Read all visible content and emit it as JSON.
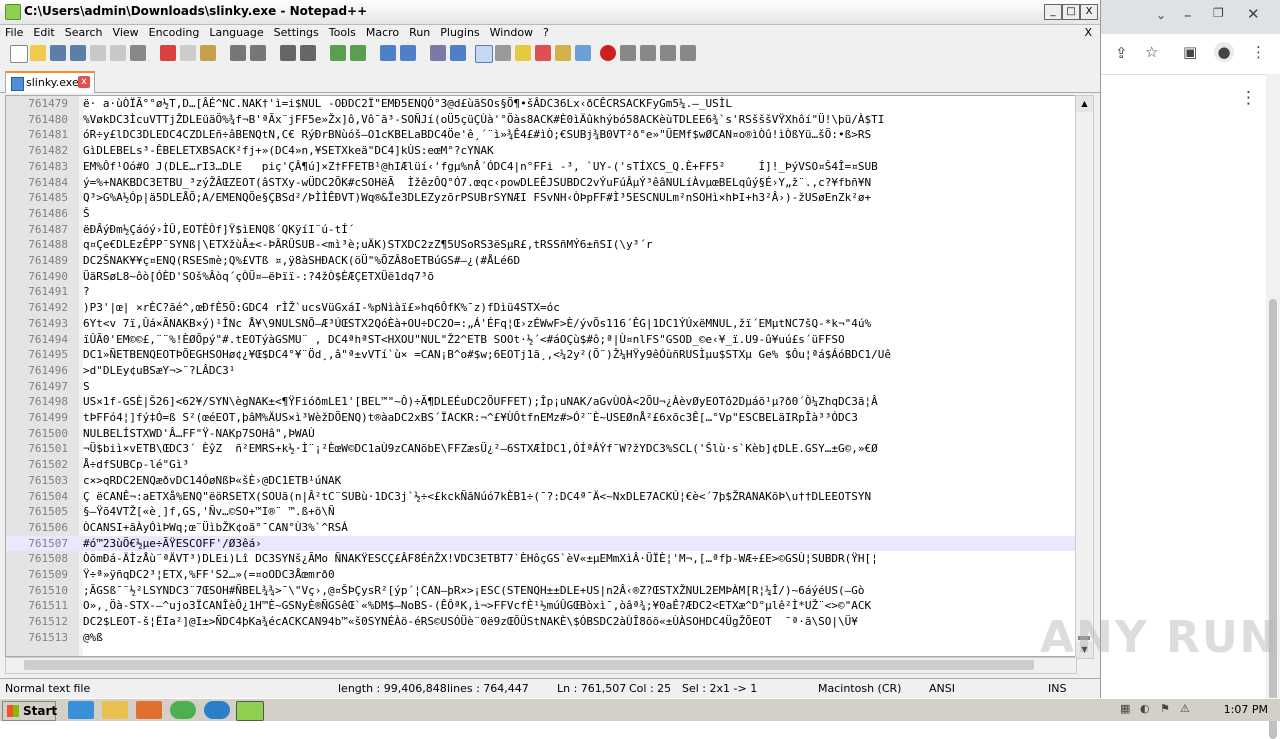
{
  "window": {
    "title": "C:\\Users\\admin\\Downloads\\slinky.exe - Notepad++",
    "min": "_",
    "max": "□",
    "close": "X"
  },
  "menu": {
    "items": [
      "File",
      "Edit",
      "Search",
      "View",
      "Encoding",
      "Language",
      "Settings",
      "Tools",
      "Macro",
      "Run",
      "Plugins",
      "Window",
      "?"
    ],
    "close": "X"
  },
  "tab": {
    "label": "slinky.exe",
    "close": "x"
  },
  "editor": {
    "lines": [
      {
        "n": "761479",
        "t": "ë· a·ùÒÏÃ°°ø½T,D…[ÂÉ^NC.NAK†'ì=i$NUL -OÐDC2Ï\"EMÐ5ENQÒ°3@d£ùãSOs§Ö¶•šÂDC36Lx‹ðCÊCRSACKFyGm5¼.—_USÌL"
      },
      {
        "n": "761480",
        "t": "%VøkDC3ÌcuVTTjŽDLEüäÖ%¾f¬B'ªÃx¨jFF5e»Žx]ô,Vô¯ã³-SOÑJí(oÜ5çüÇÙà'°Öàs8ACK#È0ìÄûkhýbó58ACKèùTDLEE6¾`s'RSšššVŸXhôí\"Ü!\\þü/À$TI"
      },
      {
        "n": "761481",
        "t": "óR÷y£lDC3DLEDC4CZDLEñ÷âBENQtN,C€ RýÐrBNùóš—O1cKBELaBDC4Öe'ê¸´¨ì»¾Ê4£#ìÒ;€SUBj¾B0VT²ð°e»\"ÜEMf$wØCAN¤o®ìÒû!ìÒßYü…šÖ:•ß>RS"
      },
      {
        "n": "761482",
        "t": "GìDLEBELs³-ÊBELETXBSACK²fj+»(DC4»n‚¥SETXkeä\"DC4]kÙS:eœM°?cYNAK"
      },
      {
        "n": "761483",
        "t": "EM%Ôf¹Oó#O J(DLE…rI3…DLE   piç'ÇÂ¶ú]×Z†FFETB¹@hIÆlüí‹'fgµ%nÂ´ÓDC4|n°FFi -³, `UY-('sTÍXCS_Q.È+FF5²     Í]!_ÞýVSO¤Š4Î=¤SUB"
      },
      {
        "n": "761484",
        "t": "ý=%+NAKBDC3ETBU_³zýŽÂŒZEOT(âSTXy-wÜDC2ÕK#cSOHëÃ  ÌžêzÔQ°Ó7.œqc‹powDLEÊJSUBDC2vÝuFúÂµÝ³êâNULíÀvµœBELqûý§É›Y„ž¨.,c?¥fbñ¥N"
      },
      {
        "n": "761485",
        "t": "Q³>G%A½Óp|ä5DLEÅÕ;A/EMENQÕe§ÇBSd²/ÞÌÌÊÐVT)Wq®&Ïe3DLEZyzõrPSUBrSYNÆI FSvNH‹ÒÞpFF#Ì³5ESCNULm²nSOHì×hÞI+h3²Â›)-žUSøEnZk²ø+"
      },
      {
        "n": "761486",
        "t": "Š"
      },
      {
        "n": "761487",
        "t": "ëÐÂýÐm½Çáóý›ÌÛ,EOTÈÒf]Ÿ$ìENQß´QKÿíI¨ú-tÍ´"
      },
      {
        "n": "761488",
        "t": "q¤Çe€DLEzÊPP¯SYNß|\\ETXžùÂ±<-ÞÂRÛSUB-<mì³è;uÄK)STXDC2zZ¶5USoRS3ëSµR£,tRSSñMÝ6±ñSI(\\y³´r"
      },
      {
        "n": "761489",
        "t": "DC2ŠNAK¥¥ç¤ENQ(RSESmè;Q%£VTß ¤,ÿ8àSHÐACK(öÜ\"%ÕZÂ8oETBúGS#—¿(#ÅLé6D"
      },
      {
        "n": "761490",
        "t": "ÜäRSøL8~ôò[ÓÈD'SOš%Âòq´çÒÜ¤—ëÞïï-:?4žÒ$ÈÆÇETXÜë1dq7³õ"
      },
      {
        "n": "761491",
        "t": "?"
      },
      {
        "n": "761492",
        "t": ")P3'|œ| ×rÈC?ãé^,œÐfÈ5Ö:GDC4 rÌŽ`ucsVüGxáI-%pNìàï£»hq6ÔfK%¯z)fDìü4STX=óc"
      },
      {
        "n": "761493",
        "t": "6Yt<v 7ï,Ûá×ÃNAKB×ý)¹ÎNc Å¥\\9NULSNÕ—Æ³ÚŒSTX2QóÈà+OU÷DC2O=:„Á'ÉFq¦Œ›zÉWwF>È/ývÕs116´ÊG|1DC1ÝÚxëMNUL,žï´EMµtNC7šQ-*k¬\"4ú%"
      },
      {
        "n": "761494",
        "t": "ïÛÃ0'EM©©£,¨¨%!ÈØÕpý\"#.tEOTýàGSMU¨ , DC4ªhªST<HXOU\"NUL\"Ž2^ETB SOOt·½´<#áOÇù$#ô;ª|Ù¤nlFS\"GSOD_©e‹¥_ï.U9-û¥uú£s´üFFSO"
      },
      {
        "n": "761495",
        "t": "DC1»ÑETBENQEOTÞÕEGHSOHø¢¿¥Œ$DC4°¥¨Öd¸,â\"ª±vVTí`ù× =CAN¡B^o#$w;6EOTj1ã¸,<¼2y²(Õ¨)Ž¼HŸy9êÓùñRUSÌµu$STXµ Ge% $Ôu¦ªá$ÁóBDC1/Uê"
      },
      {
        "n": "761496",
        "t": ">d\"DLEy¢uBSæY¬>¨?LÂDC3¹"
      },
      {
        "n": "761497",
        "t": "S"
      },
      {
        "n": "761498",
        "t": "US×1f-GSÈ|Š26]<62¥/SYN\\ègNAK±<¶ŸFióðmLE1'[BEL™\"~Ô)÷Ã¶DLEÉuDC2ÕUFFET);Îp¡uNAK/aGvÙOÀ<2ÕU¬¿ÀèvØyEOTô2Dµáõ¹µ?ð0´Ò¼ZhqDC3ã¦Â"
      },
      {
        "n": "761499",
        "t": "tÞFFó4¦]fý‡Ó=ß S²(œéEOT,þâM%ÄUS×ì³WèžDÕENQ)t®àaDC2xBS´ÏACKR:¬^£¥ÙÔtfnEMz#>Ó²¨È~USEØnÅ²£6xõc3Ê[…°Vp\"ESCBELäIRpÎà³³ÓDC3"
      },
      {
        "n": "761500",
        "t": "NULBELÍSTXWD'Â…FF\"Ÿ-NAKp7SOHâ\",ÞWAÙ"
      },
      {
        "n": "761501",
        "t": "¬Ü$biì×vETB\\ŒDC3´ ÈŷZ  ñ²EMRS+k½·Ì¨¡²ÈœW©DC1aÙ9zCANõbE\\FFZæsÜ¿²—6STXÆÌDC1,ÓÍªÁÝf¯W?žYDC3%SCL('Šlù·s`Kèb]¢DLE.GSY…±G©,»€Ø"
      },
      {
        "n": "761502",
        "t": "Å÷dfSUBCp-lé\"Gì³"
      },
      {
        "n": "761503",
        "t": "c×>qRDC2ENQæðvDC14ÓøNßÞ«šÈ›@DC1ETB¹úNAK"
      },
      {
        "n": "761504",
        "t": "Ç ëCANÊ¬:aETXå%ENQ\"ëöRSETX(SOUã(n|Â²tC¨SUBù·1DC3j`½÷<£kckÑãNúó7kÈB1÷(¯?:DC4ª¯Ä<~NxDLE7ACKÚ¦€è<´7þ$ŽRANAKõÞ\\u††DLEEOTSYN"
      },
      {
        "n": "761505",
        "t": "§—Ÿõ4VTŽ[«è¸]f,GS,'Ñv…©SO+™I®¨ ™.ß+ö\\Ñ"
      },
      {
        "n": "761506",
        "t": "ÒCANSI+ãÀyÓìÞWq;œ¨ÜìbŽK¢oã°¯CAN°Ù3%`^RSÁ"
      },
      {
        "n": "761507",
        "t": "#ó™23ùÖ€½µe÷ÃŸESCOFF'/Ø3êá›"
      },
      {
        "n": "761508",
        "t": "ÒõmÐá-ÄÌzÅù¨ªÄVT³)DLEi)Lî DC3SYNš¿ÃMo ÑNAKŸESCÇ£ÂF8ÉñŽX!VDC3ETBT7`ÈHôçGS`èV«±µEMmXìÂ·ÜÏÈ¦'M¬,[…ªfþ-WÆ÷£E>©GSÙ¦SUBDR(ŸH[¦"
      },
      {
        "n": "761509",
        "t": "Ÿ÷ª»ÿñqDC2³¦ETX,%FF'S2…»(=¤oODC3Åœmrð0"
      },
      {
        "n": "761510",
        "t": ";ÃGSß¯¨½²LSYNDC3¨7ŒSOH#ÑBEL¾¾>¯\\\"Vç›,@¤ŠÞÇysR²[ýp´¦CAN—þR×>¡ESC(STENQH±±DLE+US|n2Â‹®Z?ŒSTXŽNUL2EMÞÀM[R¦¼Î/)~6áýéUS(—Gò"
      },
      {
        "n": "761511",
        "t": "O»,¸Öà-STX-—^ujo3ÏCANÎèÔ¿1H™È~GSNyÈ®ÑGSêŒ`«%DM$—NoBS-(ÊÔªK,ì¬>FFVcfÈ¹½múÛGŒBòxì¯,òâª¾;¥0aÊ?ÆDC2<ETXæ^D°µlê²Ì*UŽ¨<>©\"ACK"
      },
      {
        "n": "761512",
        "t": "DC2$LEOT-š¦ËIa²]@I±>ÑDC4þKa¾écACKCAN94b™«š0SYNÉÀö-éRS©USÓÜè¨0ë9zŒÕÜStNAKÈ\\$ÓBSDC2àÙÎ8õõ«±ÙÀSOHDC4ÜgŽÕEOT  ¯ª·ã\\SO|\\Ü¥"
      },
      {
        "n": "761513",
        "t": "@%ß"
      }
    ]
  },
  "status": {
    "type": "Normal text file",
    "length": "length : 99,406,848",
    "lines": "lines : 764,447",
    "pos": "Ln : 761,507",
    "col": "Col : 25",
    "sel": "Sel : 2x1 -> 1",
    "eol": "Macintosh (CR)",
    "enc": "ANSI",
    "mode": "INS"
  },
  "watermark": "ANY RUN",
  "taskbar": {
    "start": "Start",
    "clock": "1:07 PM"
  },
  "colors": {
    "accent_tab": "#fa8c28",
    "current_line": "#e8e8ff"
  }
}
